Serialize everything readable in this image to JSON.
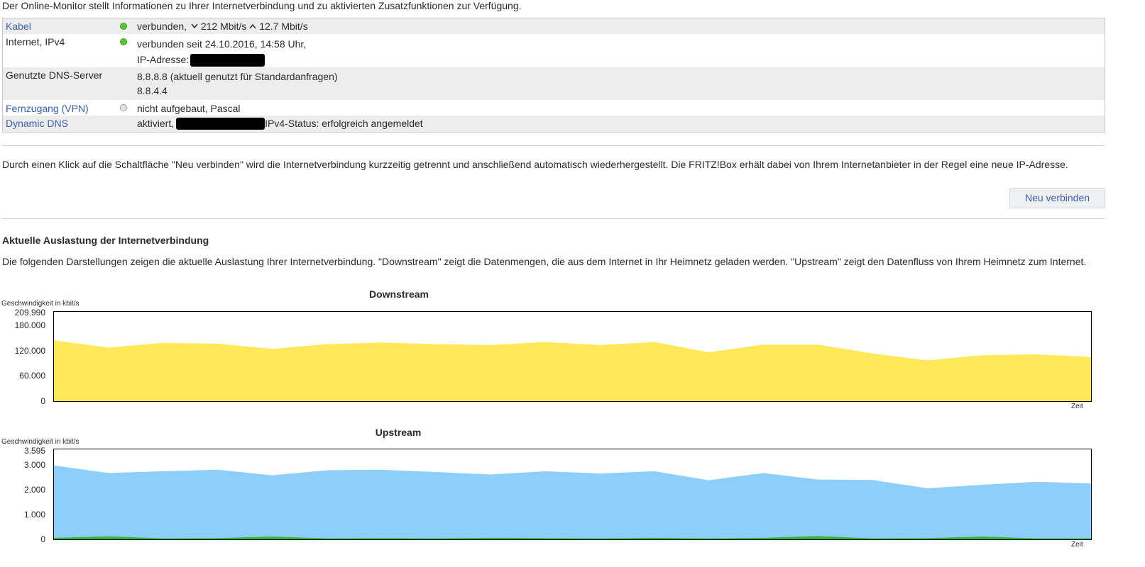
{
  "intro": "Der Online-Monitor stellt Informationen zu Ihrer Internetverbindung und zu aktivierten Zusatzfunktionen zur Verfügung.",
  "status_rows": [
    {
      "label": "Kabel",
      "led": "green",
      "line1_prefix": "verbunden,",
      "down_icon": "chevron-down-icon",
      "down": "212 Mbit/s",
      "up_icon": "chevron-up-icon",
      "up": "12.7 Mbit/s"
    },
    {
      "label": "Internet, IPv4",
      "led": "green",
      "line1": "verbunden seit 24.10.2016, 14:58 Uhr,",
      "line2_prefix": "IP-Adresse:"
    },
    {
      "label": "Genutzte DNS-Server",
      "line1": "8.8.8.8 (aktuell genutzt für Standardanfragen)",
      "line2": "8.8.4.4"
    },
    {
      "label": "Fernzugang (VPN)",
      "led": "grey",
      "line1": "nicht aufgebaut, Pascal"
    },
    {
      "label": "Dynamic DNS",
      "line1_prefix": "aktiviert,",
      "line1_suffix": "IPv4-Status: erfolgreich angemeldet"
    }
  ],
  "reconnect_text": "Durch einen Klick auf die Schaltfläche \"Neu verbinden\" wird die Internetverbindung kurzzeitig getrennt und anschließend automatisch wiederhergestellt. Die FRITZ!Box erhält dabei von Ihrem Internetanbieter in der Regel eine neue IP-Adresse.",
  "reconnect_button": "Neu verbinden",
  "usage_heading": "Aktuelle Auslastung der Internetverbindung",
  "usage_text": "Die folgenden Darstellungen zeigen die aktuelle Auslastung Ihrer Internetverbindung. \"Downstream\" zeigt die Datenmengen, die aus dem Internet in Ihr Heimnetz geladen werden. \"Upstream\" zeigt den Datenfluss von Ihrem Heimnetz zum Internet.",
  "colors": {
    "downstream": "#ffe95a",
    "upstream": "#8dcffa",
    "upstream_low": "#3ab03a",
    "link": "#3a5fa8"
  },
  "chart_data": [
    {
      "type": "area",
      "title": "Downstream",
      "ylabel": "Geschwindigkeit in kbit/s",
      "xlabel": "Zeit",
      "ylim": [
        0,
        209990
      ],
      "yticks": [
        0,
        60000,
        120000,
        180000,
        209990
      ],
      "ytick_labels": [
        "0",
        "60.000",
        "120.000",
        "180.000",
        "209.990"
      ],
      "series": [
        {
          "values": [
            143000,
            126000,
            137000,
            135000,
            123000,
            134000,
            138000,
            134000,
            132000,
            139000,
            132000,
            139000,
            115000,
            133000,
            133000,
            112000,
            96000,
            108000,
            110000,
            104000
          ]
        }
      ]
    },
    {
      "type": "area",
      "title": "Upstream",
      "ylabel": "Geschwindigkeit in kbit/s",
      "xlabel": "Zeit",
      "ylim": [
        0,
        3595
      ],
      "yticks": [
        0,
        1000,
        2000,
        3000,
        3595
      ],
      "ytick_labels": [
        "0",
        "1.000",
        "2.000",
        "3.000",
        "3.595"
      ],
      "series": [
        {
          "values": [
            2950,
            2650,
            2720,
            2780,
            2560,
            2760,
            2780,
            2690,
            2590,
            2720,
            2630,
            2720,
            2360,
            2650,
            2390,
            2370,
            2040,
            2180,
            2300,
            2230
          ]
        },
        {
          "values": [
            60,
            120,
            40,
            50,
            110,
            40,
            50,
            40,
            60,
            50,
            40,
            60,
            40,
            60,
            130,
            40,
            50,
            110,
            40,
            40
          ]
        }
      ]
    }
  ]
}
